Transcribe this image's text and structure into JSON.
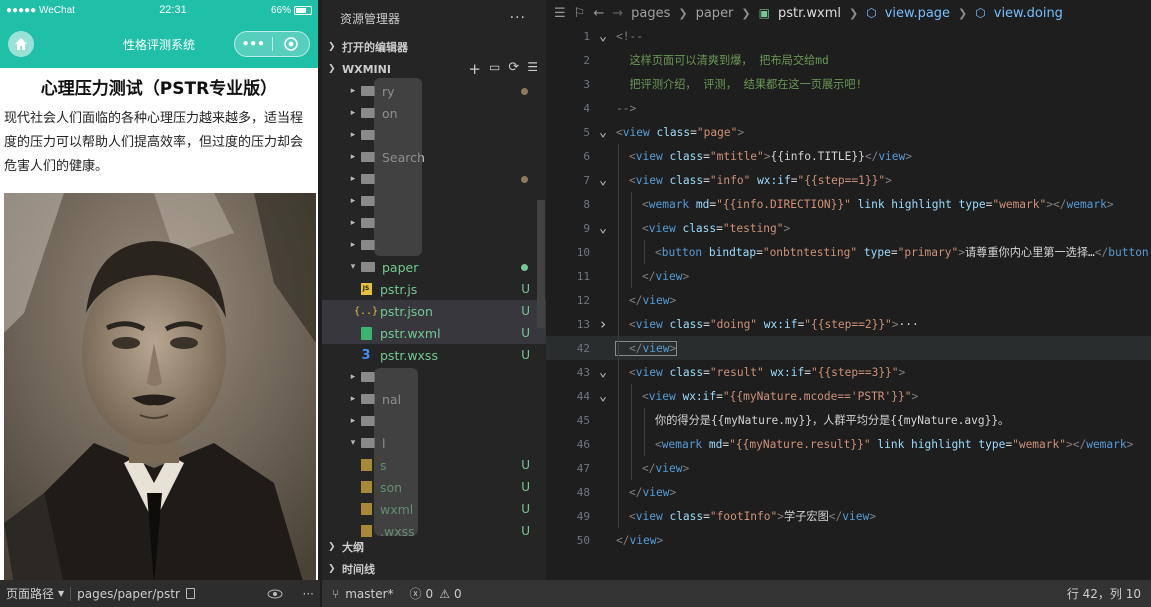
{
  "phone": {
    "status": {
      "carrier": "●●●●● WeChat",
      "time": "22:31",
      "battery": "66%"
    },
    "nav_title": "性格评测系统",
    "capsule_menu": "•••",
    "title": "心理压力测试（PSTR专业版）",
    "description": "现代社会人们面临的各种心理压力越来越多，适当程度的压力可以帮助人们提高效率，但过度的压力却会危害人们的健康。"
  },
  "phone_bottom": {
    "path_label": "页面路径",
    "path": "pages/paper/pstr"
  },
  "explorer": {
    "title": "资源管理器",
    "open_editors": "打开的编辑器",
    "project": "WXMINI",
    "tree": [
      {
        "label": "ry",
        "type": "folder",
        "dot": true
      },
      {
        "label": "on",
        "type": "folder"
      },
      {
        "label": "",
        "type": "folder"
      },
      {
        "label": "Search",
        "type": "folder"
      },
      {
        "label": "",
        "type": "folder",
        "dot": true
      },
      {
        "label": "",
        "type": "folder"
      },
      {
        "label": "",
        "type": "folder"
      },
      {
        "label": "",
        "type": "folder"
      },
      {
        "label": "paper",
        "type": "folder-open",
        "dot": true
      },
      {
        "label": "pstr.js",
        "type": "js",
        "status": "U"
      },
      {
        "label": "pstr.json",
        "type": "json",
        "status": "U"
      },
      {
        "label": "pstr.wxml",
        "type": "wxml",
        "status": "U"
      },
      {
        "label": "pstr.wxss",
        "type": "wxss",
        "status": "U"
      },
      {
        "label": "",
        "type": "folder"
      },
      {
        "label": "nal",
        "type": "folder"
      },
      {
        "label": "",
        "type": "folder"
      },
      {
        "label": "l",
        "type": "folder-open"
      },
      {
        "label": "s",
        "type": "file",
        "status": "U"
      },
      {
        "label": "son",
        "type": "file",
        "status": "U"
      },
      {
        "label": "wxml",
        "type": "file",
        "status": "U"
      },
      {
        "label": ".wxss",
        "type": "file",
        "status": "U"
      }
    ],
    "outline": "大纲",
    "timeline": "时间线"
  },
  "editor": {
    "breadcrumb": [
      "pages",
      "paper",
      "pstr.wxml",
      "view.page",
      "view.doing"
    ],
    "lines": [
      {
        "n": "1",
        "fold": "v",
        "indent": 0,
        "html": "<span class='t-gr'>&lt;!--</span>"
      },
      {
        "n": "2",
        "fold": "",
        "indent": 0,
        "html": "<span class='t-cm'>  这样页面可以清爽到爆， 把布局交给md</span>"
      },
      {
        "n": "3",
        "fold": "",
        "indent": 0,
        "html": "<span class='t-cm'>  把评测介绍， 评测， 结果都在这一页展示吧!</span>"
      },
      {
        "n": "4",
        "fold": "",
        "indent": 0,
        "html": "<span class='t-gr'>--&gt;</span>"
      },
      {
        "n": "5",
        "fold": "v",
        "indent": 0,
        "html": "<span class='t-gr'>&lt;</span><span class='t-tag'>view</span> <span class='t-attr'>class</span><span class='t-pl'>=</span><span class='t-str'>\"page\"</span><span class='t-gr'>&gt;</span>"
      },
      {
        "n": "6",
        "fold": "",
        "indent": 1,
        "html": "<span class='t-gr'>&lt;</span><span class='t-tag'>view</span> <span class='t-attr'>class</span><span class='t-pl'>=</span><span class='t-str'>\"mtitle\"</span><span class='t-gr'>&gt;</span><span class='t-pl'>{{info.TITLE}}</span><span class='t-gr'>&lt;/</span><span class='t-tag'>view</span><span class='t-gr'>&gt;</span>"
      },
      {
        "n": "7",
        "fold": "v",
        "indent": 1,
        "html": "<span class='t-gr'>&lt;</span><span class='t-tag'>view</span> <span class='t-attr'>class</span><span class='t-pl'>=</span><span class='t-str'>\"info\"</span> <span class='t-attr'>wx:if</span><span class='t-pl'>=</span><span class='t-str'>\"{{step==1}}\"</span><span class='t-gr'>&gt;</span>"
      },
      {
        "n": "8",
        "fold": "",
        "indent": 2,
        "html": "<span class='t-gr'>&lt;</span><span class='t-tag'>wemark</span> <span class='t-attr'>md</span><span class='t-pl'>=</span><span class='t-str'>\"{{info.DIRECTION}}\"</span> <span class='t-attr'>link highlight type</span><span class='t-pl'>=</span><span class='t-str'>\"wemark\"</span><span class='t-gr'>&gt;&lt;/</span><span class='t-tag'>wemark</span><span class='t-gr'>&gt;</span>"
      },
      {
        "n": "9",
        "fold": "v",
        "indent": 2,
        "html": "<span class='t-gr'>&lt;</span><span class='t-tag'>view</span> <span class='t-attr'>class</span><span class='t-pl'>=</span><span class='t-str'>\"testing\"</span><span class='t-gr'>&gt;</span>"
      },
      {
        "n": "10",
        "fold": "",
        "indent": 3,
        "html": "<span class='t-gr'>&lt;</span><span class='t-tag'>button</span> <span class='t-attr'>bindtap</span><span class='t-pl'>=</span><span class='t-str'>\"onbtntesting\"</span> <span class='t-attr'>type</span><span class='t-pl'>=</span><span class='t-str'>\"primary\"</span><span class='t-gr'>&gt;</span><span class='t-pl'>请尊重你内心里第一选择…</span><span class='t-gr'>&lt;/</span><span class='t-tag'>button</span>"
      },
      {
        "n": "11",
        "fold": "",
        "indent": 2,
        "html": "<span class='t-gr'>&lt;/</span><span class='t-tag'>view</span><span class='t-gr'>&gt;</span>"
      },
      {
        "n": "12",
        "fold": "",
        "indent": 1,
        "html": "<span class='t-gr'>&lt;/</span><span class='t-tag'>view</span><span class='t-gr'>&gt;</span>"
      },
      {
        "n": "13",
        "fold": ">",
        "indent": 1,
        "html": "<span class='t-gr'>&lt;</span><span class='t-tag'>view</span> <span class='t-attr'>class</span><span class='t-pl'>=</span><span class='t-str'>\"doing\"</span> <span class='t-attr'>wx:if</span><span class='t-pl'>=</span><span class='t-str'>\"{{step==2}}\"</span><span class='t-gr'>&gt;</span><span class='t-pl'>···</span>"
      },
      {
        "n": "42",
        "fold": "",
        "indent": 1,
        "cur": true,
        "html": "<span class='t-gr'>&lt;/</span><span class='t-tag'>view</span><span class='t-gr'>&gt;</span>"
      },
      {
        "n": "43",
        "fold": "v",
        "indent": 1,
        "html": "<span class='t-gr'>&lt;</span><span class='t-tag'>view</span> <span class='t-attr'>class</span><span class='t-pl'>=</span><span class='t-str'>\"result\"</span> <span class='t-attr'>wx:if</span><span class='t-pl'>=</span><span class='t-str'>\"{{step==3}}\"</span><span class='t-gr'>&gt;</span>"
      },
      {
        "n": "44",
        "fold": "v",
        "indent": 2,
        "html": "<span class='t-gr'>&lt;</span><span class='t-tag'>view</span> <span class='t-attr'>wx:if</span><span class='t-pl'>=</span><span class='t-str'>\"{{myNature.mcode=='PSTR'}}\"</span><span class='t-gr'>&gt;</span>"
      },
      {
        "n": "45",
        "fold": "",
        "indent": 3,
        "html": "<span class='t-pl'>你的得分是{{myNature.my}}，人群平均分是{{myNature.avg}}。</span>"
      },
      {
        "n": "46",
        "fold": "",
        "indent": 3,
        "html": "<span class='t-gr'>&lt;</span><span class='t-tag'>wemark</span> <span class='t-attr'>md</span><span class='t-pl'>=</span><span class='t-str'>\"{{myNature.result}}\"</span> <span class='t-attr'>link highlight type</span><span class='t-pl'>=</span><span class='t-str'>\"wemark\"</span><span class='t-gr'>&gt;&lt;/</span><span class='t-tag'>wemark</span><span class='t-gr'>&gt;</span>"
      },
      {
        "n": "47",
        "fold": "",
        "indent": 2,
        "html": "<span class='t-gr'>&lt;/</span><span class='t-tag'>view</span><span class='t-gr'>&gt;</span>"
      },
      {
        "n": "48",
        "fold": "",
        "indent": 1,
        "html": "<span class='t-gr'>&lt;/</span><span class='t-tag'>view</span><span class='t-gr'>&gt;</span>"
      },
      {
        "n": "49",
        "fold": "",
        "indent": 1,
        "html": "<span class='t-gr'>&lt;</span><span class='t-tag'>view</span> <span class='t-attr'>class</span><span class='t-pl'>=</span><span class='t-str'>\"footInfo\"</span><span class='t-gr'>&gt;</span><span class='t-pl'>学子宏图</span><span class='t-gr'>&lt;/</span><span class='t-tag'>view</span><span class='t-gr'>&gt;</span>"
      },
      {
        "n": "50",
        "fold": "",
        "indent": 0,
        "html": "<span class='t-gr'>&lt;/</span><span class='t-tag'>view</span><span class='t-gr'>&gt;</span>"
      }
    ]
  },
  "statusbar": {
    "branch": "master*",
    "errors": "0",
    "warnings": "0",
    "cursor": "行 42，列 10"
  },
  "colors": {
    "accent": "#1fbfa8",
    "untracked": "#73c991",
    "folder": "#c09553"
  }
}
